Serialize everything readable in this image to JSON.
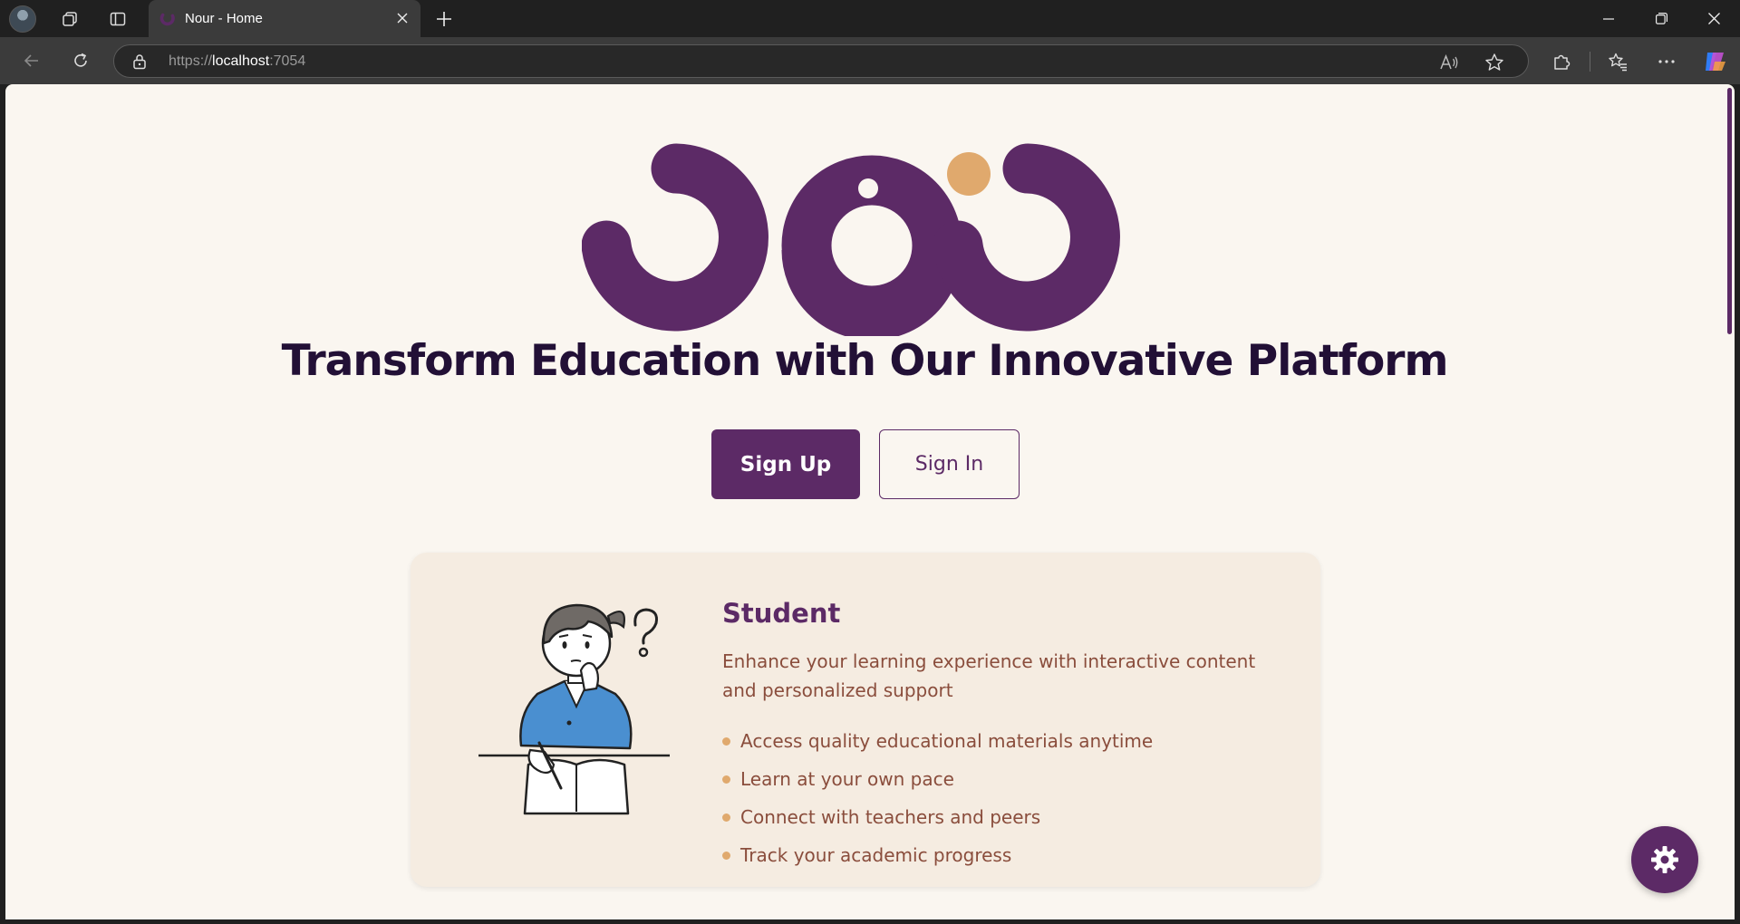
{
  "browser": {
    "tab_title": "Nour - Home",
    "url_prefix": "https://",
    "url_host": "localhost",
    "url_port": ":7054"
  },
  "colors": {
    "brand_purple": "#5c2a66",
    "accent_orange": "#e0a96d",
    "title_dark": "#221036",
    "body_brown": "#8a4d3c",
    "page_bg": "#faf6f0",
    "card_bg": "#f5ece1"
  },
  "hero": {
    "logo_alt": "نور",
    "title": "Transform Education with Our Innovative Platform",
    "signup_label": "Sign Up",
    "signin_label": "Sign In"
  },
  "student_card": {
    "title": "Student",
    "description": "Enhance your learning experience with interactive content and personalized support",
    "features": [
      "Access quality educational materials anytime",
      "Learn at your own pace",
      "Connect with teachers and peers",
      "Track your academic progress"
    ]
  },
  "icons": {
    "settings_fab": "gear-icon"
  }
}
